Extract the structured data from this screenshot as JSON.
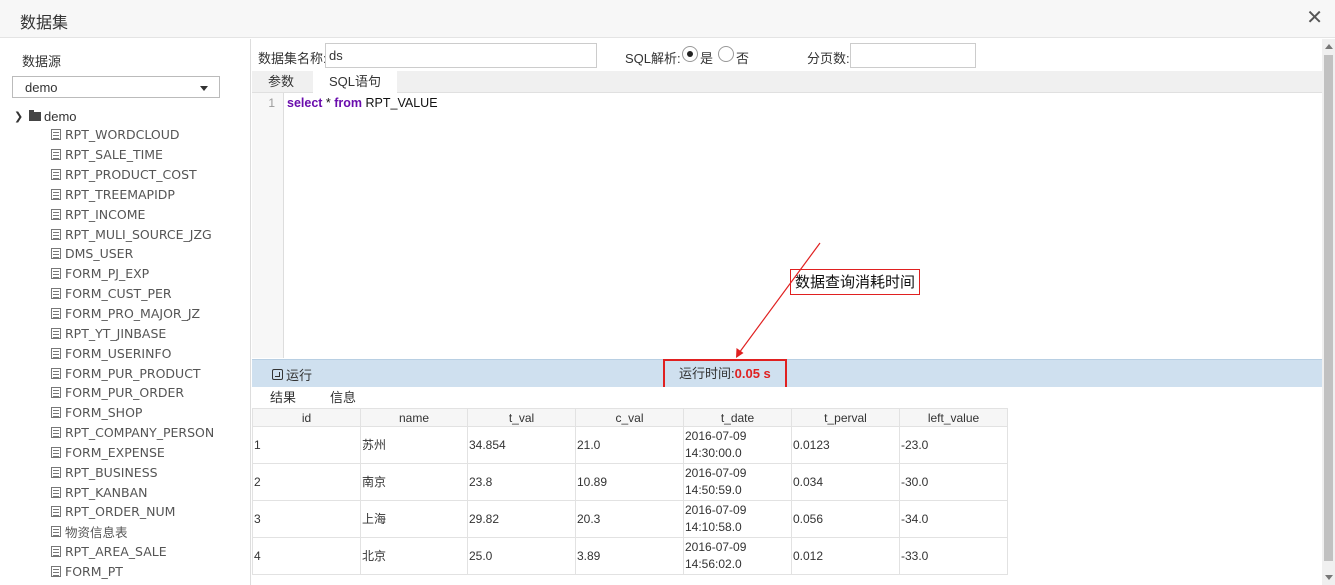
{
  "dialog": {
    "title": "数据集",
    "close_glyph": "✕"
  },
  "sidebar": {
    "datasource_label": "数据源",
    "datasource_selected": "demo",
    "tree_root": "demo",
    "tables": [
      "RPT_WORDCLOUD",
      "RPT_SALE_TIME",
      "RPT_PRODUCT_COST",
      "RPT_TREEMAPIDP",
      "RPT_INCOME",
      "RPT_MULI_SOURCE_JZG",
      "DMS_USER",
      "FORM_PJ_EXP",
      "FORM_CUST_PER",
      "FORM_PRO_MAJOR_JZ",
      "RPT_YT_JINBASE",
      "FORM_USERINFO",
      "FORM_PUR_PRODUCT",
      "FORM_PUR_ORDER",
      "FORM_SHOP",
      "RPT_COMPANY_PERSON",
      "FORM_EXPENSE",
      "RPT_BUSINESS",
      "RPT_KANBAN",
      "RPT_ORDER_NUM",
      "物资信息表",
      "RPT_AREA_SALE",
      "FORM_PT"
    ]
  },
  "form": {
    "name_label": "数据集名称:",
    "name_value": "ds",
    "sql_parse_label": "SQL解析:",
    "yes_label": "是",
    "no_label": "否",
    "page_size_label": "分页数:",
    "page_size_value": ""
  },
  "editor_tabs": [
    "参数",
    "SQL语句"
  ],
  "editor": {
    "line_number": "1",
    "kw_select": "select",
    "star": " * ",
    "kw_from": "from",
    "table": " RPT_VALUE"
  },
  "annotation": {
    "text": "数据查询消耗时间"
  },
  "runbar": {
    "run_label": "运行",
    "runtime_label": "运行时间:",
    "runtime_value": "0.05 s"
  },
  "result_tabs": [
    "结果",
    "信息"
  ],
  "results": {
    "columns": [
      "id",
      "name",
      "t_val",
      "c_val",
      "t_date",
      "t_perval",
      "left_value"
    ],
    "rows": [
      [
        "1",
        "苏州",
        "34.854",
        "21.0",
        "2016-07-09 14:30:00.0",
        "0.0123",
        "-23.0"
      ],
      [
        "2",
        "南京",
        "23.8",
        "10.89",
        "2016-07-09 14:50:59.0",
        "0.034",
        "-30.0"
      ],
      [
        "3",
        "上海",
        "29.82",
        "20.3",
        "2016-07-09 14:10:58.0",
        "0.056",
        "-34.0"
      ],
      [
        "4",
        "北京",
        "25.0",
        "3.89",
        "2016-07-09 14:56:02.0",
        "0.012",
        "-33.0"
      ]
    ]
  },
  "colors": {
    "accent_red": "#e02020",
    "runbar_bg": "#cfe0ef",
    "keyword": "#6a0dad"
  }
}
